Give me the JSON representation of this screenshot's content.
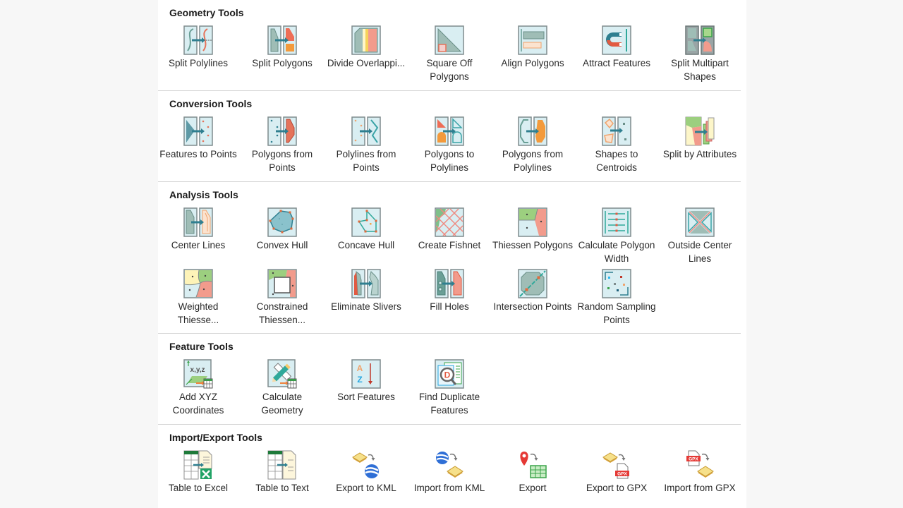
{
  "sections": [
    {
      "title": "Geometry Tools",
      "tools": [
        {
          "label": "Split Polylines",
          "icon": "split-polylines-icon"
        },
        {
          "label": "Split Polygons",
          "icon": "split-polygons-icon"
        },
        {
          "label": "Divide Overlappi...",
          "icon": "divide-overlapping-icon"
        },
        {
          "label": "Square Off Polygons",
          "icon": "square-off-polygons-icon"
        },
        {
          "label": "Align Polygons",
          "icon": "align-polygons-icon"
        },
        {
          "label": "Attract Features",
          "icon": "attract-features-icon"
        },
        {
          "label": "Split Multipart Shapes",
          "icon": "split-multipart-icon"
        }
      ]
    },
    {
      "title": "Conversion Tools",
      "tools": [
        {
          "label": "Features to Points",
          "icon": "features-to-points-icon"
        },
        {
          "label": "Polygons from Points",
          "icon": "polygons-from-points-icon"
        },
        {
          "label": "Polylines from Points",
          "icon": "polylines-from-points-icon"
        },
        {
          "label": "Polygons to Polylines",
          "icon": "polygons-to-polylines-icon"
        },
        {
          "label": "Polygons from Polylines",
          "icon": "polygons-from-polylines-icon"
        },
        {
          "label": "Shapes to Centroids",
          "icon": "shapes-to-centroids-icon"
        },
        {
          "label": "Split by Attributes",
          "icon": "split-by-attributes-icon"
        }
      ]
    },
    {
      "title": "Analysis Tools",
      "tools": [
        {
          "label": "Center Lines",
          "icon": "center-lines-icon"
        },
        {
          "label": "Convex Hull",
          "icon": "convex-hull-icon"
        },
        {
          "label": "Concave Hull",
          "icon": "concave-hull-icon"
        },
        {
          "label": "Create Fishnet",
          "icon": "create-fishnet-icon"
        },
        {
          "label": "Thiessen Polygons",
          "icon": "thiessen-polygons-icon"
        },
        {
          "label": "Calculate Polygon Width",
          "icon": "calculate-polygon-width-icon"
        },
        {
          "label": "Outside Center Lines",
          "icon": "outside-center-lines-icon"
        },
        {
          "label": "Weighted Thiesse...",
          "icon": "weighted-thiessen-icon"
        },
        {
          "label": "Constrained Thiessen...",
          "icon": "constrained-thiessen-icon"
        },
        {
          "label": "Eliminate Slivers",
          "icon": "eliminate-slivers-icon"
        },
        {
          "label": "Fill Holes",
          "icon": "fill-holes-icon"
        },
        {
          "label": "Intersection Points",
          "icon": "intersection-points-icon"
        },
        {
          "label": "Random Sampling Points",
          "icon": "random-sampling-points-icon"
        }
      ]
    },
    {
      "title": "Feature Tools",
      "tools": [
        {
          "label": "Add XYZ Coordinates",
          "icon": "add-xyz-coordinates-icon"
        },
        {
          "label": "Calculate Geometry",
          "icon": "calculate-geometry-icon"
        },
        {
          "label": "Sort Features",
          "icon": "sort-features-icon"
        },
        {
          "label": "Find Duplicate Features",
          "icon": "find-duplicate-features-icon"
        }
      ]
    },
    {
      "title": "Import/Export Tools",
      "tools": [
        {
          "label": "Table to Excel",
          "icon": "table-to-excel-icon"
        },
        {
          "label": "Table to Text",
          "icon": "table-to-text-icon"
        },
        {
          "label": "Export to KML",
          "icon": "export-to-kml-icon"
        },
        {
          "label": "Import from KML",
          "icon": "import-from-kml-icon"
        },
        {
          "label": "Export",
          "icon": "export-icon"
        },
        {
          "label": "Export to GPX",
          "icon": "export-to-gpx-icon"
        },
        {
          "label": "Import from GPX",
          "icon": "import-from-gpx-icon"
        }
      ]
    }
  ],
  "icon_glyphs": {
    "xyz_text": "x,y,z",
    "sort_a": "A",
    "sort_z": "Z",
    "duplicate_letter": "D",
    "gpx_text": "GPX"
  }
}
